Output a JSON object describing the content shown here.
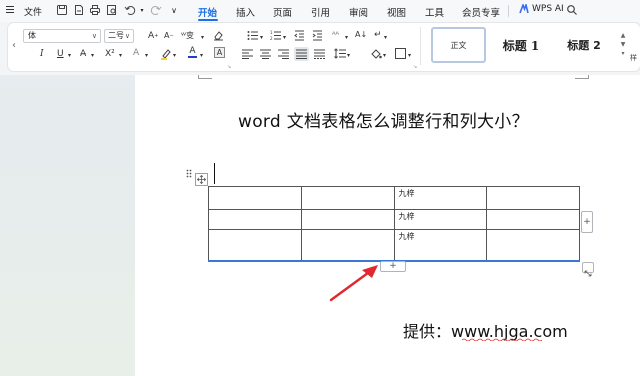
{
  "menubar": {
    "file_label": "文件",
    "tabs": [
      {
        "label": "开始",
        "active": true
      },
      {
        "label": "插入",
        "active": false
      },
      {
        "label": "页面",
        "active": false
      },
      {
        "label": "引用",
        "active": false
      },
      {
        "label": "审阅",
        "active": false
      },
      {
        "label": "视图",
        "active": false
      },
      {
        "label": "工具",
        "active": false
      },
      {
        "label": "会员专享",
        "active": false
      }
    ],
    "wps_ai_label": "WPS AI",
    "accent_color": "#1f6fe5"
  },
  "ribbon": {
    "font_name": "体",
    "font_size": "二号",
    "icons": [
      "increase-font-icon",
      "decrease-font-icon",
      "phonetic-icon",
      "clear-format-icon",
      "italic-icon",
      "underline-icon",
      "strikethrough-icon",
      "superscript-icon",
      "text-effect-icon",
      "highlight-icon",
      "font-color-icon",
      "char-border-icon",
      "bullet-list-icon",
      "numbered-list-icon",
      "decrease-indent-icon",
      "increase-indent-icon",
      "chinese-layout-icon",
      "sort-icon",
      "show-marks-icon",
      "align-left-icon",
      "align-center-icon",
      "align-right-icon",
      "justify-icon",
      "distribute-icon",
      "line-spacing-icon",
      "shading-icon",
      "border-icon"
    ],
    "styles": {
      "normal": "正文",
      "heading1": "标题 1",
      "heading2": "标题 2",
      "more": "样"
    }
  },
  "document": {
    "title": "word 文档表格怎么调整行和列大小？",
    "table": {
      "rows": [
        [
          "",
          "",
          "九梓",
          ""
        ],
        [
          "",
          "",
          "九梓",
          ""
        ],
        [
          "",
          "",
          "九梓",
          ""
        ]
      ],
      "add_row_label": "+",
      "add_col_label": "+"
    },
    "provider_label": "提供：",
    "provider_url": "www.hjga.com",
    "arrow_color": "#e0282e"
  }
}
